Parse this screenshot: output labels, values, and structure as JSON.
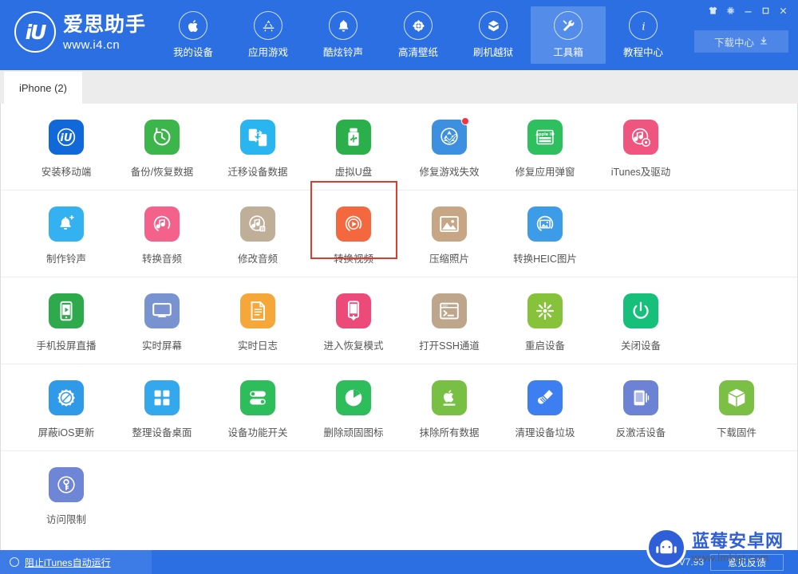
{
  "window": {
    "controls": [
      {
        "name": "theme-icon",
        "glyph": "shirt"
      },
      {
        "name": "settings-icon",
        "glyph": "gear"
      },
      {
        "name": "minimize-icon",
        "glyph": "minimize"
      },
      {
        "name": "maximize-icon",
        "glyph": "maximize"
      },
      {
        "name": "close-icon",
        "glyph": "close"
      }
    ]
  },
  "brand": {
    "mark": "iU",
    "name": "爱思助手",
    "url": "www.i4.cn"
  },
  "nav": {
    "items": [
      {
        "label": "我的设备",
        "icon": "apple-icon",
        "active": false
      },
      {
        "label": "应用游戏",
        "icon": "appstore-icon",
        "active": false
      },
      {
        "label": "酷炫铃声",
        "icon": "bell-icon",
        "active": false
      },
      {
        "label": "高清壁纸",
        "icon": "flower-icon",
        "active": false
      },
      {
        "label": "刷机越狱",
        "icon": "box-open-icon",
        "active": false
      },
      {
        "label": "工具箱",
        "icon": "tools-icon",
        "active": true
      },
      {
        "label": "教程中心",
        "icon": "info-icon",
        "active": false
      }
    ],
    "download_center": "下载中心"
  },
  "tabs": [
    {
      "label": "iPhone (2)",
      "active": true
    }
  ],
  "toolbox": {
    "rows": [
      {
        "cells": [
          {
            "label": "安装移动端",
            "icon": "i4-app-icon",
            "color": "#1168d8",
            "badge": false,
            "selected": false
          },
          {
            "label": "备份/恢复数据",
            "icon": "backup-restore-icon",
            "color": "#3cb54a",
            "badge": false,
            "selected": false
          },
          {
            "label": "迁移设备数据",
            "icon": "migrate-data-icon",
            "color": "#29b6f0",
            "badge": false,
            "selected": false
          },
          {
            "label": "虚拟U盘",
            "icon": "usb-drive-icon",
            "color": "#2aaf4b",
            "badge": false,
            "selected": false
          },
          {
            "label": "修复游戏失效",
            "icon": "fix-game-icon",
            "color": "#3d8fdf",
            "badge": true,
            "selected": false
          },
          {
            "label": "修复应用弹窗",
            "icon": "apple-id-icon",
            "color": "#2ec05e",
            "badge": false,
            "selected": false
          },
          {
            "label": "iTunes及驱动",
            "icon": "itunes-driver-icon",
            "color": "#f0557f",
            "badge": false,
            "selected": false
          }
        ]
      },
      {
        "cells": [
          {
            "label": "制作铃声",
            "icon": "make-ringtone-icon",
            "color": "#33b1f0",
            "badge": false,
            "selected": false
          },
          {
            "label": "转换音频",
            "icon": "convert-audio-icon",
            "color": "#f4628c",
            "badge": false,
            "selected": false
          },
          {
            "label": "修改音频",
            "icon": "edit-audio-icon",
            "color": "#bfae98",
            "badge": false,
            "selected": false
          },
          {
            "label": "转换视频",
            "icon": "convert-video-icon",
            "color": "#f4683f",
            "badge": false,
            "selected": true
          },
          {
            "label": "压缩照片",
            "icon": "compress-photo-icon",
            "color": "#c6a685",
            "badge": false,
            "selected": false
          },
          {
            "label": "转换HEIC图片",
            "icon": "convert-heic-icon",
            "color": "#3d9ce8",
            "badge": false,
            "selected": false
          }
        ]
      },
      {
        "cells": [
          {
            "label": "手机投屏直播",
            "icon": "screen-cast-icon",
            "color": "#2eaa4c",
            "badge": false,
            "selected": false
          },
          {
            "label": "实时屏幕",
            "icon": "live-screen-icon",
            "color": "#7893cf",
            "badge": false,
            "selected": false
          },
          {
            "label": "实时日志",
            "icon": "live-log-icon",
            "color": "#f5a839",
            "badge": false,
            "selected": false
          },
          {
            "label": "进入恢复模式",
            "icon": "recovery-mode-icon",
            "color": "#ec4a79",
            "badge": false,
            "selected": false
          },
          {
            "label": "打开SSH通道",
            "icon": "ssh-terminal-icon",
            "color": "#bda68c",
            "badge": false,
            "selected": false
          },
          {
            "label": "重启设备",
            "icon": "reboot-device-icon",
            "color": "#86c33a",
            "badge": false,
            "selected": false
          },
          {
            "label": "关闭设备",
            "icon": "shutdown-device-icon",
            "color": "#16c07a",
            "badge": false,
            "selected": false
          }
        ]
      },
      {
        "cells": [
          {
            "label": "屏蔽iOS更新",
            "icon": "block-ios-update-icon",
            "color": "#2e9ae8",
            "badge": false,
            "selected": false
          },
          {
            "label": "整理设备桌面",
            "icon": "organize-desktop-icon",
            "color": "#34a8ec",
            "badge": false,
            "selected": false
          },
          {
            "label": "设备功能开关",
            "icon": "feature-toggle-icon",
            "color": "#2ebd5b",
            "badge": false,
            "selected": false
          },
          {
            "label": "删除顽固图标",
            "icon": "remove-icon-icon",
            "color": "#2ebd5b",
            "badge": false,
            "selected": false
          },
          {
            "label": "抹除所有数据",
            "icon": "erase-data-icon",
            "color": "#78c043",
            "badge": false,
            "selected": false
          },
          {
            "label": "清理设备垃圾",
            "icon": "clean-junk-icon",
            "color": "#3d7ff0",
            "badge": false,
            "selected": false
          },
          {
            "label": "反激活设备",
            "icon": "deactivate-device-icon",
            "color": "#6c82d4",
            "badge": false,
            "selected": false
          },
          {
            "label": "下载固件",
            "icon": "download-firmware-icon",
            "color": "#7bc044",
            "badge": false,
            "selected": false
          }
        ]
      },
      {
        "cells": [
          {
            "label": "访问限制",
            "icon": "access-restriction-icon",
            "color": "#6f85d6",
            "badge": false,
            "selected": false
          }
        ]
      }
    ]
  },
  "footer": {
    "block_itunes": "阻止iTunes自动运行",
    "version": "V7.93",
    "feedback": "意见反馈"
  },
  "watermark": {
    "name": "蓝莓安卓网",
    "url": "www.lmkjst.com"
  },
  "colors": {
    "brand_blue": "#2c6fe2",
    "selection_red": "#e03b2f",
    "tab_strip": "#ececec"
  }
}
